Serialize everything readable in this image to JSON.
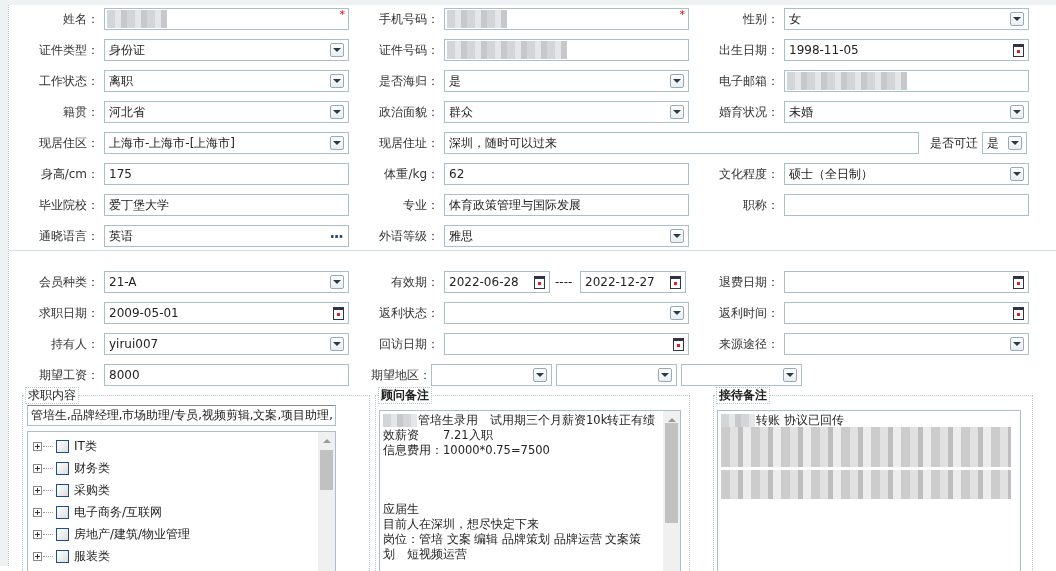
{
  "required_marker": "*",
  "personal_rows": [
    [
      {
        "label": "姓名：",
        "kind": "text",
        "required": true,
        "redacted": true
      },
      {
        "label": "手机号码：",
        "kind": "text",
        "required": true,
        "redacted": true
      },
      {
        "label": "性别：",
        "kind": "select",
        "required": false,
        "redacted": false,
        "value": "女"
      }
    ],
    [
      {
        "label": "证件类型：",
        "kind": "select",
        "required": false,
        "redacted": false,
        "value": "身份证"
      },
      {
        "label": "证件号码：",
        "kind": "text",
        "required": false,
        "redacted": true
      },
      {
        "label": "出生日期：",
        "kind": "date",
        "required": false,
        "redacted": false,
        "value": "1998-11-05"
      }
    ],
    [
      {
        "label": "工作状态：",
        "kind": "select",
        "required": false,
        "redacted": false,
        "value": "离职"
      },
      {
        "label": "是否海归：",
        "kind": "select",
        "required": false,
        "redacted": false,
        "value": "是"
      },
      {
        "label": "电子邮箱：",
        "kind": "text",
        "required": false,
        "redacted": true
      }
    ],
    [
      {
        "label": "籍贯：",
        "kind": "select",
        "required": false,
        "redacted": false,
        "value": "河北省"
      },
      {
        "label": "政治面貌：",
        "kind": "select",
        "required": false,
        "redacted": false,
        "value": "群众"
      },
      {
        "label": "婚育状况：",
        "kind": "select",
        "required": false,
        "redacted": false,
        "value": "未婚"
      }
    ],
    [
      {
        "label": "现居住区：",
        "kind": "select",
        "required": false,
        "redacted": false,
        "value": "上海市-上海市-[上海市]"
      },
      {
        "label": "现居住址：",
        "kind": "address",
        "required": false,
        "redacted": false,
        "value": "深圳，随时可以过来",
        "relocate": {
          "label": "是否可迁",
          "value": "是"
        }
      }
    ],
    [
      {
        "label": "身高/cm：",
        "kind": "text",
        "required": false,
        "redacted": false,
        "value": "175"
      },
      {
        "label": "体重/kg：",
        "kind": "text",
        "required": false,
        "redacted": false,
        "value": "62"
      },
      {
        "label": "文化程度：",
        "kind": "select",
        "required": false,
        "redacted": false,
        "value": "硕士（全日制）"
      }
    ],
    [
      {
        "label": "毕业院校：",
        "kind": "text",
        "required": false,
        "redacted": false,
        "value": "爱丁堡大学"
      },
      {
        "label": "专业：",
        "kind": "text",
        "required": false,
        "redacted": false,
        "value": "体育政策管理与国际发展"
      },
      {
        "label": "职称：",
        "kind": "text",
        "required": false,
        "redacted": false
      }
    ],
    [
      {
        "label": "通晓语言：",
        "kind": "picker",
        "required": false,
        "redacted": false,
        "value": "英语"
      },
      {
        "label": "外语等级：",
        "kind": "select",
        "required": false,
        "redacted": false,
        "value": "雅思"
      }
    ]
  ],
  "membership_rows": [
    [
      {
        "label": "会员种类：",
        "kind": "select",
        "value": "21-A"
      },
      {
        "label": "有效期：",
        "kind": "daterange",
        "value": "2022-06-28",
        "separator": "----",
        "end_value": "2022-12-27"
      },
      {
        "label": "退费日期：",
        "kind": "date"
      }
    ],
    [
      {
        "label": "求职日期：",
        "kind": "date",
        "value": "2009-05-01"
      },
      {
        "label": "返利状态：",
        "kind": "select"
      },
      {
        "label": "返利时间：",
        "kind": "date"
      }
    ],
    [
      {
        "label": "持有人：",
        "kind": "select",
        "value": "yirui007"
      },
      {
        "label": "回访日期：",
        "kind": "date"
      },
      {
        "label": "来源途径：",
        "kind": "select"
      }
    ],
    [
      {
        "label": "期望工资：",
        "kind": "text",
        "value": "8000"
      },
      {
        "label": "期望地区：",
        "kind": "region"
      }
    ]
  ],
  "job_panel": {
    "title": "求职内容",
    "summary": "管培生,品牌经理,市场助理/专员,视频剪辑,文案,项目助理,",
    "tree": [
      {
        "label": "IT类",
        "expanded": false,
        "checked": false
      },
      {
        "label": "财务类",
        "expanded": false,
        "checked": false
      },
      {
        "label": "采购类",
        "expanded": false,
        "checked": false
      },
      {
        "label": "电子商务/互联网",
        "expanded": false,
        "checked": false
      },
      {
        "label": "房地产/建筑/物业管理",
        "expanded": false,
        "checked": false
      },
      {
        "label": "服装类",
        "expanded": false,
        "checked": false
      }
    ]
  },
  "notes": [
    {
      "title": "顾问备注",
      "scrollbar": true,
      "redacted_block": false,
      "paragraphs": [
        [
          {
            "text": "管培生录用　试用期三个月薪资10k转正有绩",
            "redacted": true
          },
          {
            "text": "效薪资　　7.21入职",
            "redacted": false
          },
          {
            "text": "信息费用：10000*0.75=7500",
            "redacted": false
          }
        ],
        [
          {
            "text": "应届生",
            "redacted": false
          },
          {
            "text": "目前人在深圳，想尽快定下来",
            "redacted": false
          },
          {
            "text": "岗位：管培 文案 编辑 品牌策划 品牌运营 文案策",
            "redacted": false
          },
          {
            "text": "划　短视频运营",
            "redacted": false
          }
        ]
      ]
    },
    {
      "title": "接待备注",
      "scrollbar": false,
      "redacted_block": true,
      "paragraphs": [
        [
          {
            "text": "转账 协议已回传",
            "redacted": true
          }
        ]
      ]
    }
  ]
}
